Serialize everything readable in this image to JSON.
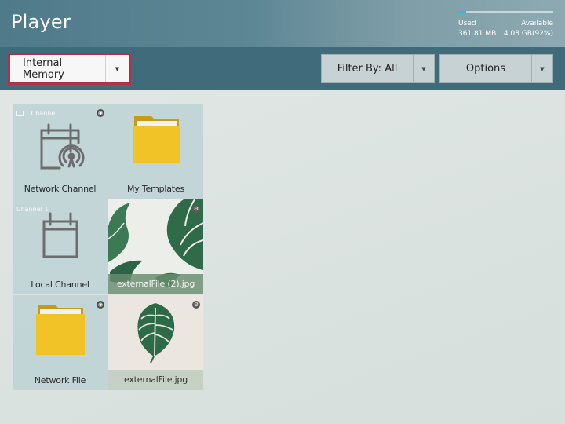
{
  "app": {
    "title": "Player"
  },
  "storage": {
    "used_label": "Used",
    "used_value": "361.81 MB",
    "available_label": "Available",
    "available_value": "4.08 GB(92%)",
    "used_fraction": 0.08,
    "accent_color": "#3fb6d6"
  },
  "toolbar": {
    "memory_select": {
      "value": "Internal Memory",
      "arrow": "▼"
    },
    "filter": {
      "label": "Filter By: All",
      "arrow": "▼"
    },
    "options": {
      "label": "Options",
      "arrow": "▼"
    },
    "focus_color": "#b3304a"
  },
  "items": [
    {
      "label": "Network Channel",
      "tag": "1 Channel",
      "icon": "network-channel-icon",
      "badge": "globe-icon"
    },
    {
      "label": "My Templates",
      "icon": "folder-icon"
    },
    {
      "label": "Local Channel",
      "tag": "Channel 1",
      "icon": "calendar-icon"
    },
    {
      "label": "externalFile (2).jpg",
      "icon": "monstera-photo",
      "badge": "settings-icon"
    },
    {
      "label": "Network File",
      "icon": "folder-icon",
      "badge": "globe-icon"
    },
    {
      "label": "externalFile.jpg",
      "icon": "leaf-photo",
      "badge": "settings-icon"
    }
  ]
}
